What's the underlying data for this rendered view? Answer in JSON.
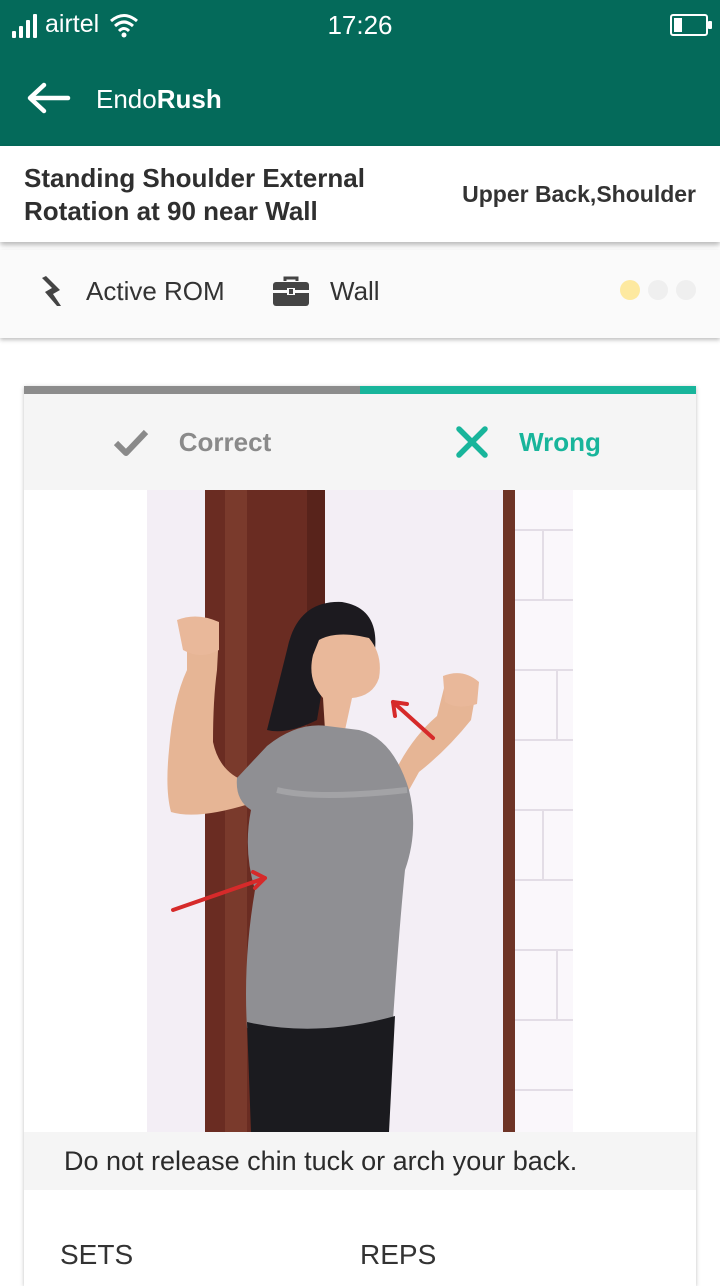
{
  "status_bar": {
    "carrier": "airtel",
    "time": "17:26",
    "icons": [
      "signal-icon",
      "wifi-icon",
      "battery-icon"
    ]
  },
  "app_bar": {
    "title_regular": "Endo",
    "title_bold": "Rush",
    "back_icon": "back-arrow-icon"
  },
  "exercise": {
    "name": "Standing Shoulder External Rotation at 90 near Wall",
    "body_area": "Upper Back,Shoulder"
  },
  "info": {
    "type_label": "Active ROM",
    "type_icon": "lightning-icon",
    "equipment_label": "Wall",
    "equipment_icon": "toolbox-icon",
    "page_dots": 3,
    "active_dot": 0
  },
  "tabs": [
    {
      "label": "Correct",
      "icon": "check-icon",
      "selected": false
    },
    {
      "label": "Wrong",
      "icon": "x-icon",
      "selected": true
    }
  ],
  "caption": "Do not release chin tuck or arch your back.",
  "stats": {
    "sets_label": "SETS",
    "reps_label": "REPS"
  },
  "colors": {
    "primary": "#046a5a",
    "accent": "#18b59b",
    "inactive": "#8a8a8a",
    "dot_active": "#fde9a0"
  }
}
